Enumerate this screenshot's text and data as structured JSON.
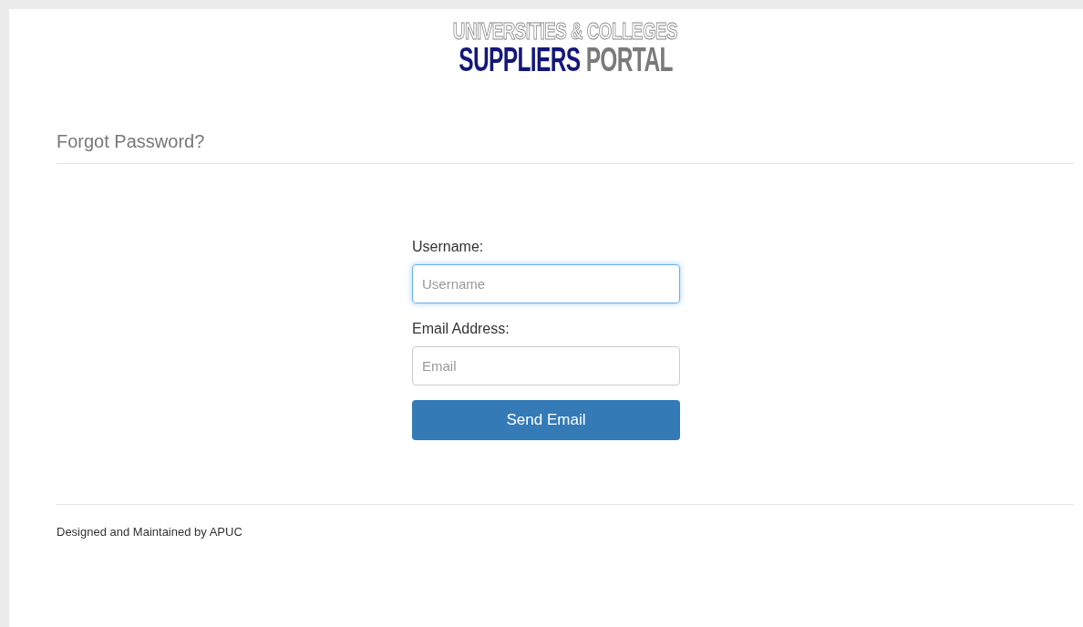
{
  "logo": {
    "line_1": "UNIVERSITIES & COLLEGES",
    "line_2_highlight": "SUPPLIERS",
    "line_2_rest": "PORTAL"
  },
  "heading": "Forgot Password?",
  "form": {
    "fields": [
      {
        "label": "Username:",
        "placeholder": "Username",
        "focused": true
      },
      {
        "label": "Email Address:",
        "placeholder": "Email",
        "focused": false
      }
    ],
    "submit": "Send Email"
  },
  "footer": "Designed and Maintained by APUC"
}
